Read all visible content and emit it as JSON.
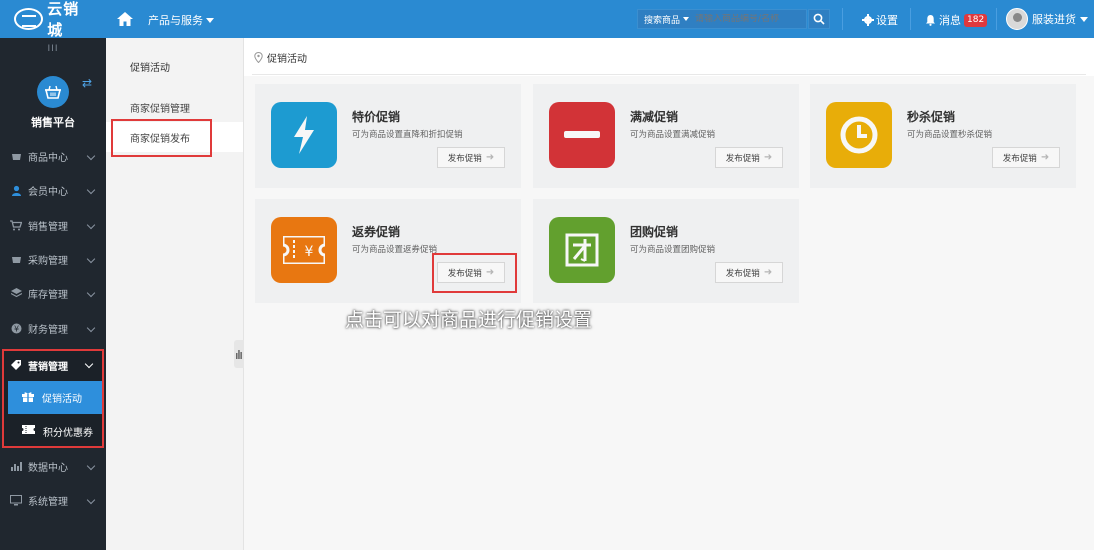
{
  "topbar": {
    "logo_text": "云销城",
    "product_menu": "产品与服务",
    "search_type": "搜索商品",
    "search_placeholder": "请输入商品编号/名称",
    "settings_label": "设置",
    "messages_label": "消息",
    "messages_count": "182",
    "user_name": "服装进货"
  },
  "sidebar": {
    "collapse_glyph": "III",
    "platform_name": "销售平台",
    "items": [
      {
        "label": "商品中心",
        "icon": "basket-icon"
      },
      {
        "label": "会员中心",
        "icon": "user-icon"
      },
      {
        "label": "销售管理",
        "icon": "cart-icon"
      },
      {
        "label": "采购管理",
        "icon": "basket-icon"
      },
      {
        "label": "库存管理",
        "icon": "layers-icon"
      },
      {
        "label": "财务管理",
        "icon": "yen-icon"
      }
    ],
    "marketing": {
      "label": "营销管理",
      "sub": [
        {
          "label": "促销活动",
          "icon": "gift-icon"
        },
        {
          "label": "积分优惠券",
          "icon": "ticket-icon"
        }
      ]
    },
    "items_after": [
      {
        "label": "数据中心",
        "icon": "bar-chart-icon"
      },
      {
        "label": "系统管理",
        "icon": "monitor-icon"
      }
    ]
  },
  "subnav": {
    "title": "促销活动",
    "items": [
      "商家促销管理",
      "商家促销发布"
    ]
  },
  "main": {
    "breadcrumb": "促销活动",
    "cards": [
      {
        "title": "特价促销",
        "desc": "可为商品设置直降和折扣促销",
        "button": "发布促销",
        "color": "#1ea0d8",
        "icon": "lightning-icon"
      },
      {
        "title": "满减促销",
        "desc": "可为商品设置满减促销",
        "button": "发布促销",
        "color": "#d93539",
        "icon": "minus-icon"
      },
      {
        "title": "秒杀促销",
        "desc": "可为商品设置秒杀促销",
        "button": "发布促销",
        "color": "#f0b30a",
        "icon": "clock-icon"
      },
      {
        "title": "返券促销",
        "desc": "可为商品设置返券促销",
        "button": "发布促销",
        "color": "#f07b12",
        "icon": "coupon-icon"
      },
      {
        "title": "团购促销",
        "desc": "可为商品设置团购促销",
        "button": "发布促销",
        "color": "#66a630",
        "icon": "group-icon"
      }
    ],
    "hint": "点击可以对商品进行促销设置"
  },
  "colors": {
    "topbar": "#2a8ad2",
    "sidebar": "#20272f",
    "active": "#2e8fdc",
    "highlight": "#e03a3a"
  }
}
